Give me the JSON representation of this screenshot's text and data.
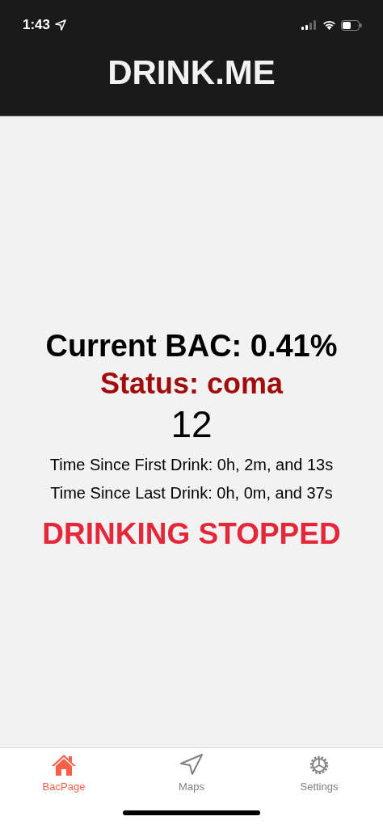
{
  "status_bar": {
    "time": "1:43"
  },
  "header": {
    "title": "DRINK.ME"
  },
  "bac": {
    "current": "Current BAC: 0.41%",
    "status": "Status: coma",
    "count": "12",
    "since_first": "Time Since First Drink: 0h, 2m, and 13s",
    "since_last": "Time Since Last Drink: 0h, 0m, and 37s",
    "alert": "DRINKING STOPPED"
  },
  "tabs": [
    {
      "label": "BacPage",
      "kind": "home",
      "selected": true
    },
    {
      "label": "Maps",
      "kind": "maps",
      "selected": false
    },
    {
      "label": "Settings",
      "kind": "settings",
      "selected": false
    }
  ]
}
